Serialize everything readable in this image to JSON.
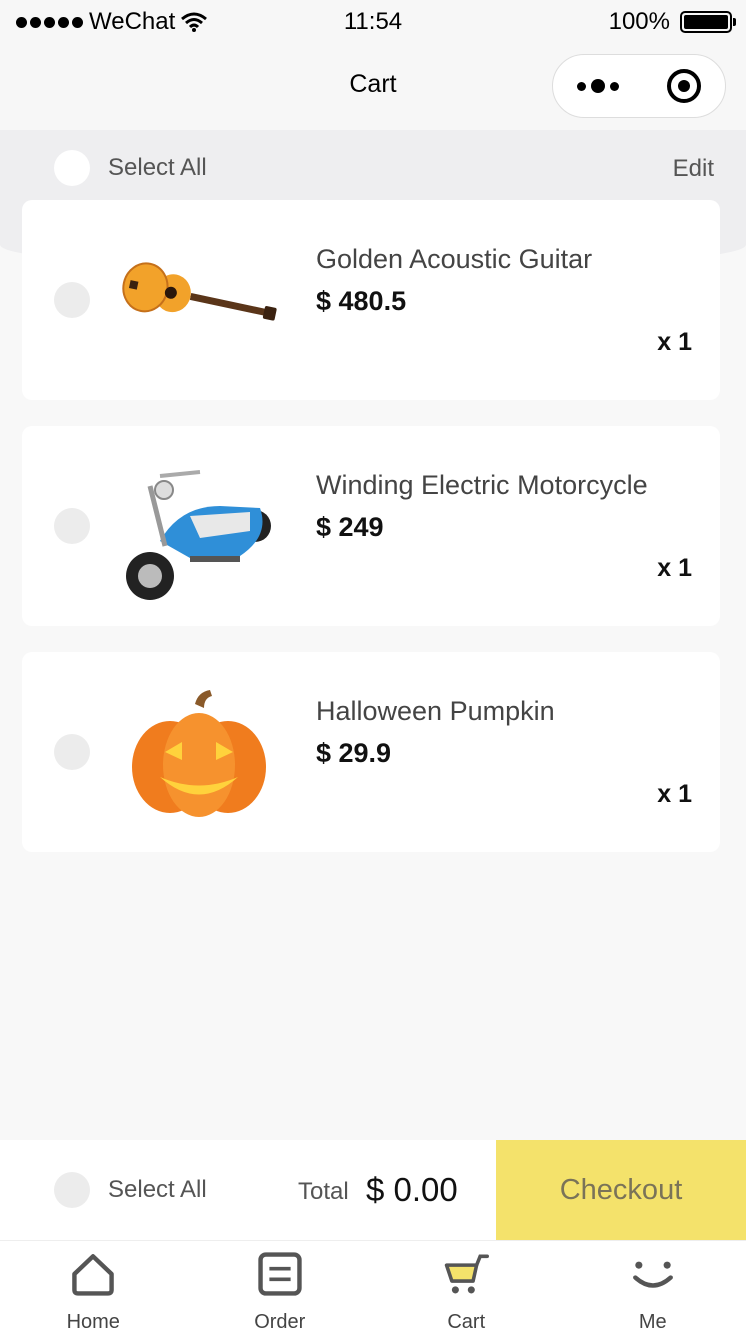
{
  "status_bar": {
    "carrier": "WeChat",
    "time": "11:54",
    "battery": "100%"
  },
  "nav": {
    "title": "Cart"
  },
  "header": {
    "select_all_label": "Select All",
    "edit_label": "Edit"
  },
  "items": [
    {
      "name": "Golden Acoustic Guitar",
      "price": "$ 480.5",
      "qty": "x 1",
      "image": "guitar-image"
    },
    {
      "name": "Winding Electric Motorcycle",
      "price": "$ 249",
      "qty": "x 1",
      "image": "motorcycle-image"
    },
    {
      "name": "Halloween Pumpkin",
      "price": "$ 29.9",
      "qty": "x 1",
      "image": "pumpkin-image"
    }
  ],
  "checkout": {
    "select_all_label": "Select All",
    "total_label": "Total",
    "total_value": "$ 0.00",
    "button_label": "Checkout"
  },
  "tabs": [
    {
      "label": "Home",
      "icon": "home-icon"
    },
    {
      "label": "Order",
      "icon": "order-icon"
    },
    {
      "label": "Cart",
      "icon": "cart-icon"
    },
    {
      "label": "Me",
      "icon": "smile-icon"
    }
  ],
  "colors": {
    "accent_yellow": "#f4e26b",
    "background": "#f8f8f8"
  }
}
